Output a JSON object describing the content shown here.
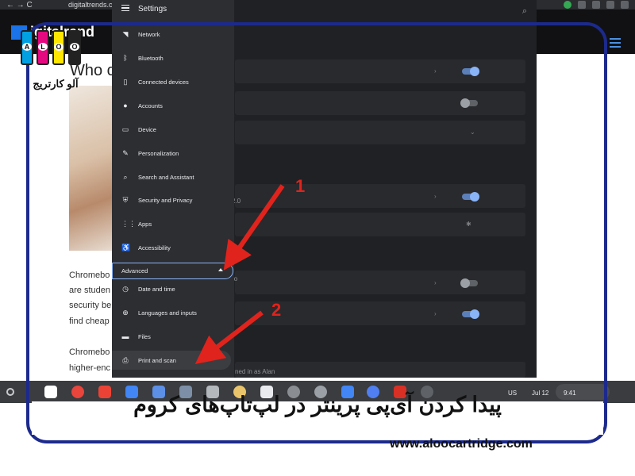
{
  "browser": {
    "url": "digitaltrends.com",
    "nav_glyphs": "← → C"
  },
  "website": {
    "logo_text": "igital",
    "logo_suffix": "rend",
    "article_title": "Who c",
    "article_lines": [
      "Chromebo",
      "are studen",
      "security be",
      "find cheap",
      "Chromebo",
      "higher-enc"
    ]
  },
  "settings": {
    "title": "Settings",
    "menu": [
      {
        "label": "Network",
        "icon": "wifi-icon"
      },
      {
        "label": "Bluetooth",
        "icon": "bluetooth-icon"
      },
      {
        "label": "Connected devices",
        "icon": "phone-icon"
      },
      {
        "label": "Accounts",
        "icon": "person-icon"
      },
      {
        "label": "Device",
        "icon": "laptop-icon"
      },
      {
        "label": "Personalization",
        "icon": "brush-icon"
      },
      {
        "label": "Search and Assistant",
        "icon": "search-icon"
      },
      {
        "label": "Security and Privacy",
        "icon": "shield-icon"
      },
      {
        "label": "Apps",
        "icon": "apps-grid-icon"
      },
      {
        "label": "Accessibility",
        "icon": "accessibility-icon"
      }
    ],
    "advanced_label": "Advanced",
    "advanced_menu": [
      {
        "label": "Date and time",
        "icon": "clock-icon"
      },
      {
        "label": "Languages and inputs",
        "icon": "globe-icon"
      },
      {
        "label": "Files",
        "icon": "folder-icon"
      },
      {
        "label": "Print and scan",
        "icon": "printer-icon"
      }
    ],
    "bg_fragments": {
      "version": "2.0",
      "signed_in": "ned in as Alan",
      "ro": "ro"
    }
  },
  "annotations": {
    "arrow1_number": "1",
    "arrow2_number": "2",
    "arrow_color": "#e0231c"
  },
  "shelf": {
    "locale": "US",
    "date": "Jul 12",
    "time": "9:41"
  },
  "branding": {
    "logo_letters": [
      "A",
      "L",
      "O",
      "O"
    ],
    "logo_persian": "آلو کارتریج",
    "caption": "پیدا کردن آی‌پی پرینتر در لپ‌تاپ‌های کروم",
    "site_url": "www.aloocartridge.com",
    "frame_color": "#1c2a8c"
  }
}
